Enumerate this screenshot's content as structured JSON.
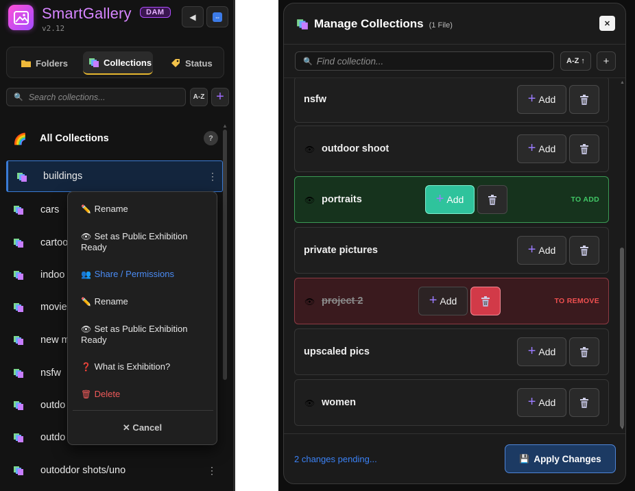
{
  "sidebar": {
    "app_name": "SmartGallery",
    "version": "v2.12",
    "badge": "DAM",
    "collapse_icon": "◀",
    "swap_icon": "⇔",
    "tabs": [
      {
        "label": "Folders",
        "icon": "folder-icon"
      },
      {
        "label": "Collections",
        "icon": "collections-icon"
      },
      {
        "label": "Status",
        "icon": "tag-icon"
      }
    ],
    "search_placeholder": "Search collections...",
    "sort_label": "A-Z",
    "add_label": "+",
    "all_collections": {
      "icon": "🌈",
      "label": "All Collections",
      "help": "?"
    },
    "items": [
      {
        "name": "buildings",
        "active": true,
        "menu": "⋮"
      },
      {
        "name": "cars"
      },
      {
        "name": "cartoo"
      },
      {
        "name": "indoo"
      },
      {
        "name": "movie"
      },
      {
        "name": "new m"
      },
      {
        "name": "nsfw"
      },
      {
        "name": "outdo"
      },
      {
        "name": "outdo"
      },
      {
        "name": "outoddor shots/uno",
        "menu": "⋮"
      }
    ]
  },
  "context_menu": {
    "items": [
      {
        "icon": "✏️",
        "label": "Rename"
      },
      {
        "icon": "👁",
        "label": "Set as Public Exhibition Ready"
      },
      {
        "icon": "👥",
        "label": "Share / Permissions"
      },
      {
        "icon": "✏️",
        "label": "Rename"
      },
      {
        "icon": "👁",
        "label": "Set as Public Exhibition Ready"
      },
      {
        "icon": "❓",
        "label": "What is Exhibition?"
      },
      {
        "icon": "🗑",
        "label": "Delete"
      }
    ],
    "cancel_label": "✕ Cancel"
  },
  "dialog": {
    "title": "Manage Collections",
    "file_count": "(1 File)",
    "close_label": "✕",
    "search_placeholder": "Find collection...",
    "sort_label": "A-Z ↑",
    "add_label": "+",
    "rows": [
      {
        "name": "nsfw",
        "public": false,
        "add_label": "Add",
        "state": ""
      },
      {
        "name": "outdoor shoot",
        "public": true,
        "add_label": "Add",
        "state": ""
      },
      {
        "name": "portraits",
        "public": true,
        "add_label": "Add",
        "state": "TO ADD"
      },
      {
        "name": "private pictures",
        "public": false,
        "add_label": "Add",
        "state": ""
      },
      {
        "name": "project 2",
        "public": true,
        "add_label": "Add",
        "state": "TO REMOVE"
      },
      {
        "name": "upscaled pics",
        "public": false,
        "add_label": "Add",
        "state": ""
      },
      {
        "name": "women",
        "public": true,
        "add_label": "Add",
        "state": ""
      }
    ],
    "pending_text": "2 changes pending...",
    "apply_label": "Apply Changes",
    "apply_icon": "💾"
  },
  "colors": {
    "brand": "#d685ff",
    "accent_blue": "#3b82f6",
    "to_add": "#41c766",
    "to_remove": "#f05050",
    "add_active": "#2fc39c",
    "remove_active": "#d23a48"
  }
}
